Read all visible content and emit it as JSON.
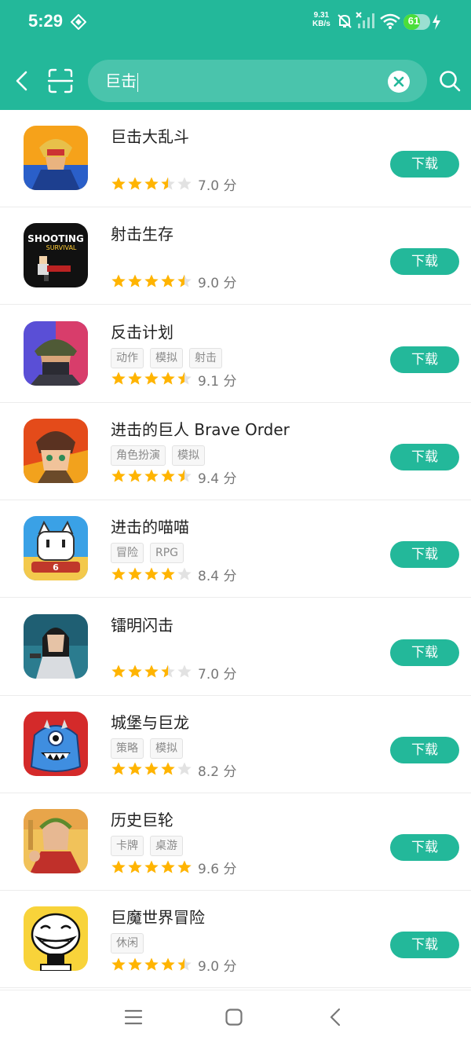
{
  "status_bar": {
    "time": "5:29",
    "net_speed_value": "9.31",
    "net_speed_unit": "KB/s",
    "battery": "61",
    "battery_level": 0.61
  },
  "search": {
    "query": "巨击"
  },
  "colors": {
    "accent": "#23b89a",
    "star_on": "#ffb400",
    "star_off": "#e2e2e2"
  },
  "apps": [
    {
      "name": "巨击大乱斗",
      "tags": [],
      "stars": 3.5,
      "score": "7.0 分",
      "button": "下载",
      "icon": "hero-warrior-icon"
    },
    {
      "name": "射击生存",
      "tags": [],
      "stars": 4.5,
      "score": "9.0 分",
      "button": "下载",
      "icon": "shooting-survival-icon"
    },
    {
      "name": "反击计划",
      "tags": [
        "动作",
        "模拟",
        "射击"
      ],
      "stars": 4.5,
      "score": "9.1 分",
      "button": "下载",
      "icon": "soldier-helmet-icon"
    },
    {
      "name": "进击的巨人 Brave Order",
      "tags": [
        "角色扮演",
        "模拟"
      ],
      "stars": 4.5,
      "score": "9.4 分",
      "button": "下载",
      "icon": "anime-boy-icon"
    },
    {
      "name": "进击的喵喵",
      "tags": [
        "冒险",
        "RPG"
      ],
      "stars": 4,
      "score": "8.4 分",
      "button": "下载",
      "icon": "white-cat-icon"
    },
    {
      "name": "镭明闪击",
      "tags": [],
      "stars": 3.5,
      "score": "7.0 分",
      "button": "下载",
      "icon": "female-agent-icon"
    },
    {
      "name": "城堡与巨龙",
      "tags": [
        "策略",
        "模拟"
      ],
      "stars": 4,
      "score": "8.2 分",
      "button": "下载",
      "icon": "blue-monster-icon"
    },
    {
      "name": "历史巨轮",
      "tags": [
        "卡牌",
        "桌游"
      ],
      "stars": 5,
      "score": "9.6 分",
      "button": "下载",
      "icon": "caesar-icon"
    },
    {
      "name": "巨魔世界冒险",
      "tags": [
        "休闲"
      ],
      "stars": 4.5,
      "score": "9.0 分",
      "button": "下载",
      "icon": "troll-face-icon"
    }
  ]
}
